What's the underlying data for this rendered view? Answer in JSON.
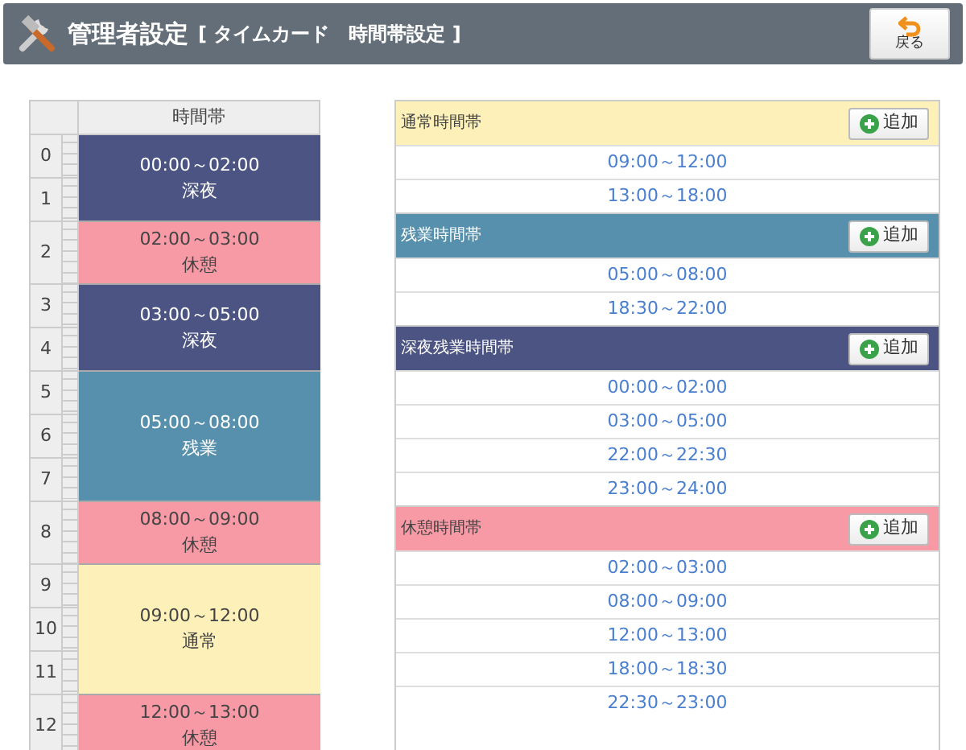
{
  "header": {
    "title": "管理者設定",
    "subtitle": "[ タイムカード　時間帯設定 ]",
    "back_button": "戻る"
  },
  "timeline": {
    "column_header": "時間帯",
    "blocks": [
      {
        "kind": "night",
        "hours": [
          "0",
          "1"
        ],
        "range": "00:00～02:00",
        "label": "深夜"
      },
      {
        "kind": "break",
        "hours": [
          "2"
        ],
        "range": "02:00～03:00",
        "label": "休憩"
      },
      {
        "kind": "night",
        "hours": [
          "3",
          "4"
        ],
        "range": "03:00～05:00",
        "label": "深夜"
      },
      {
        "kind": "overtime",
        "hours": [
          "5",
          "6",
          "7"
        ],
        "range": "05:00～08:00",
        "label": "残業"
      },
      {
        "kind": "break",
        "hours": [
          "8"
        ],
        "range": "08:00～09:00",
        "label": "休憩"
      },
      {
        "kind": "normal",
        "hours": [
          "9",
          "10",
          "11"
        ],
        "range": "09:00～12:00",
        "label": "通常"
      },
      {
        "kind": "break",
        "hours": [
          "12"
        ],
        "range": "12:00～13:00",
        "label": "休憩"
      }
    ]
  },
  "sections": [
    {
      "kind": "normal",
      "title": "通常時間帯",
      "add_button": "追加",
      "items": [
        "09:00～12:00",
        "13:00～18:00"
      ]
    },
    {
      "kind": "overtime",
      "title": "残業時間帯",
      "add_button": "追加",
      "items": [
        "05:00～08:00",
        "18:30～22:00"
      ]
    },
    {
      "kind": "night",
      "title": "深夜残業時間帯",
      "add_button": "追加",
      "items": [
        "00:00～02:00",
        "03:00～05:00",
        "22:00～22:30",
        "23:00～24:00"
      ]
    },
    {
      "kind": "break",
      "title": "休憩時間帯",
      "add_button": "追加",
      "items": [
        "02:00～03:00",
        "08:00～09:00",
        "12:00～13:00",
        "18:00～18:30",
        "22:30～23:00"
      ]
    }
  ]
}
